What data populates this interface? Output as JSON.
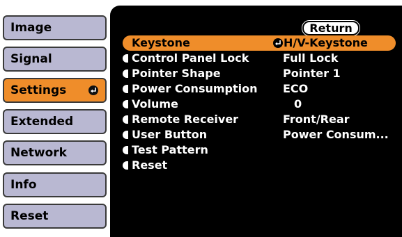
{
  "tabs": [
    {
      "label": "Image",
      "active": false
    },
    {
      "label": "Signal",
      "active": false
    },
    {
      "label": "Settings",
      "active": true
    },
    {
      "label": "Extended",
      "active": false
    },
    {
      "label": "Network",
      "active": false
    },
    {
      "label": "Info",
      "active": false
    },
    {
      "label": "Reset",
      "active": false
    }
  ],
  "panel": {
    "return_label": "Return",
    "items": [
      {
        "label": "Keystone",
        "value": "H/V-Keystone"
      },
      {
        "label": "Control Panel Lock",
        "value": "Full Lock"
      },
      {
        "label": "Pointer Shape",
        "value": "Pointer 1"
      },
      {
        "label": "Power Consumption",
        "value": "ECO"
      },
      {
        "label": "Volume",
        "value": "0"
      },
      {
        "label": "Remote Receiver",
        "value": "Front/Rear"
      },
      {
        "label": "User Button",
        "value": "Power Consum..."
      },
      {
        "label": "Test Pattern",
        "value": ""
      },
      {
        "label": "Reset",
        "value": ""
      }
    ]
  },
  "colors": {
    "tab_bg": "#b9b8d2",
    "accent": "#ef8d2a",
    "panel_bg": "#000000",
    "text_light": "#ffffff"
  },
  "icons": {
    "enter": "enter-arrow-icon"
  }
}
